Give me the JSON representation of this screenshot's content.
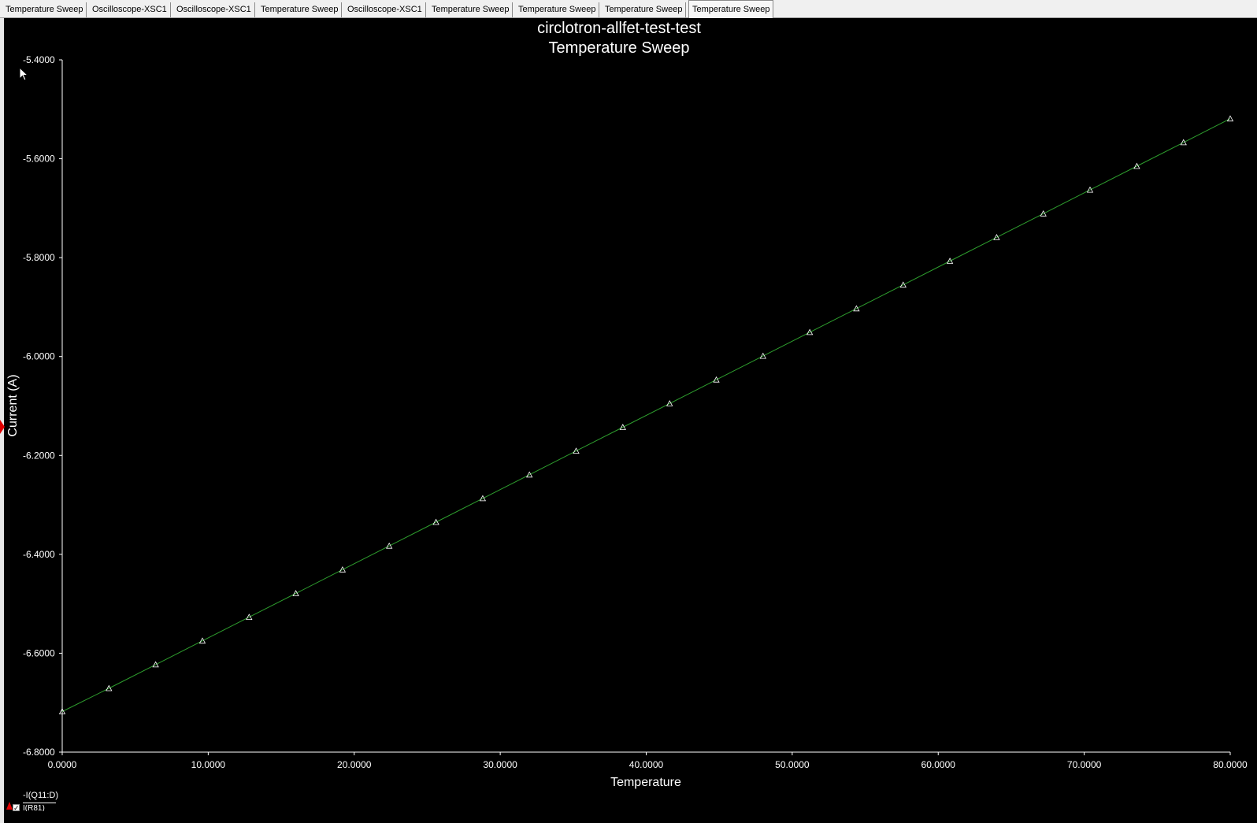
{
  "tabs": [
    {
      "label": "Temperature Sweep",
      "active": false
    },
    {
      "label": "Oscilloscope-XSC1",
      "active": false
    },
    {
      "label": "Oscilloscope-XSC1",
      "active": false
    },
    {
      "label": "Temperature Sweep",
      "active": false
    },
    {
      "label": "Oscilloscope-XSC1",
      "active": false
    },
    {
      "label": "Temperature Sweep",
      "active": false
    },
    {
      "label": "Temperature Sweep",
      "active": false
    },
    {
      "label": "Temperature Sweep",
      "active": false
    },
    {
      "label": "Temperature Sweep",
      "active": true
    }
  ],
  "legend": {
    "trace_label": "-I(Q11:D)",
    "second_label": "I(R81)"
  },
  "colors": {
    "background": "#000000",
    "axis": "#ffffff",
    "trace": "#2e9e2e",
    "marker": "#ffffff"
  },
  "chart_data": {
    "type": "line",
    "title": "circlotron-allfet-test-test",
    "subtitle": "Temperature Sweep",
    "xlabel": "Temperature",
    "ylabel": "Current (A)",
    "xlim": [
      0,
      80
    ],
    "ylim": [
      -6.8,
      -5.4
    ],
    "xticks": [
      "0.0000",
      "10.0000",
      "20.0000",
      "30.0000",
      "40.0000",
      "50.0000",
      "60.0000",
      "70.0000",
      "80.0000"
    ],
    "yticks": [
      "-5.4000",
      "-5.6000",
      "-5.8000",
      "-6.0000",
      "-6.2000",
      "-6.4000",
      "-6.6000",
      "-6.8000"
    ],
    "grid": false,
    "marker": "triangle",
    "series": [
      {
        "name": "-I(Q11:D)",
        "x": [
          0.0,
          3.2,
          6.4,
          9.6,
          12.8,
          16.0,
          19.2,
          22.4,
          25.6,
          28.8,
          32.0,
          35.2,
          38.4,
          41.6,
          44.8,
          48.0,
          51.2,
          54.4,
          57.6,
          60.8,
          64.0,
          67.2,
          70.4,
          73.6,
          76.8,
          80.0
        ],
        "y": [
          -6.718,
          -6.671,
          -6.623,
          -6.575,
          -6.527,
          -6.479,
          -6.431,
          -6.383,
          -6.335,
          -6.287,
          -6.239,
          -6.191,
          -6.143,
          -6.095,
          -6.047,
          -5.999,
          -5.951,
          -5.903,
          -5.855,
          -5.807,
          -5.759,
          -5.711,
          -5.663,
          -5.615,
          -5.567,
          -5.519
        ]
      }
    ]
  }
}
